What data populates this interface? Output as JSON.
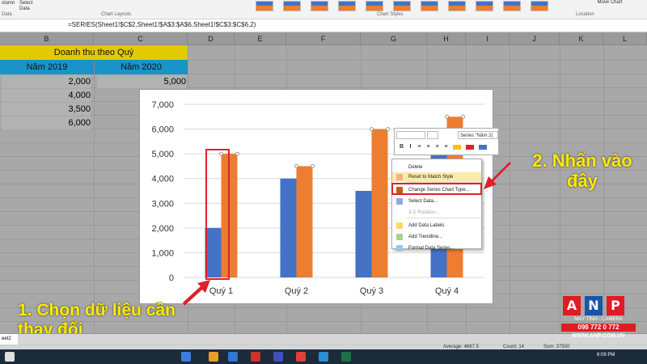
{
  "ribbon": {
    "left_buttons": [
      "Data",
      "Select",
      "Data"
    ],
    "left_labels": [
      "olumn",
      "Data"
    ],
    "chart_layouts_label": "Chart Layouts",
    "chart_styles_label": "Chart Styles",
    "move_chart_label": "Move Chart",
    "location_label": "Location"
  },
  "formula_bar": {
    "formula": "=SERIES(Sheet1!$C$2,Sheet1!$A$3:$A$6,Sheet1!$C$3:$C$6,2)"
  },
  "columns": [
    "B",
    "C",
    "D",
    "E",
    "F",
    "G",
    "H",
    "I",
    "J",
    "K",
    "L"
  ],
  "sheet": {
    "title": "Doanh thu theo Quý",
    "year_b": "Năm 2019",
    "year_c": "Năm 2020",
    "b_values": [
      "2,000",
      "4,000",
      "3,500",
      "6,000"
    ],
    "c_values": [
      "5,000"
    ]
  },
  "chart_data": {
    "type": "bar",
    "categories": [
      "Quý 1",
      "Quý 2",
      "Quý 3",
      "Quý 4"
    ],
    "series": [
      {
        "values": [
          2000,
          4000,
          3500,
          6000
        ],
        "color": "#4472c4"
      },
      {
        "values": [
          5000,
          4500,
          6000,
          6500
        ],
        "color": "#ed7d31"
      }
    ],
    "ylim": [
      0,
      7000
    ],
    "ytick_labels": [
      "0",
      "1,000",
      "2,000",
      "3,000",
      "4,000",
      "5,000",
      "6,000",
      "7,000"
    ],
    "grid": true
  },
  "mini_toolbar": {
    "series_box": "Series \"Năm 2(",
    "buttons": [
      "B",
      "I",
      "≡",
      "≡",
      "≡",
      "≡"
    ]
  },
  "context_menu": {
    "items": [
      "Delete",
      "Reset to Match Style",
      "Change Series Chart Type...",
      "Select Data...",
      "3-D Rotation...",
      "Add Data Labels",
      "Add Trendline...",
      "Format Data Series..."
    ]
  },
  "annotations": {
    "step1": "1. Chọn dữ liệu cần thay đổi",
    "step2": "2. Nhấn vào đây"
  },
  "status": {
    "sheet_tab": "eet2",
    "average": "Average: 4687.5",
    "count": "Count: 14",
    "sum": "Sum: 37500"
  },
  "taskbar": {
    "time": "6:09 PM"
  },
  "logo": {
    "letters": [
      "A",
      "N",
      "P"
    ],
    "tagline": "MÁY TÍNH - CAMERA",
    "phone": "098 772 0 772",
    "site": "WWW.ANP.COM.VN"
  },
  "colors": {
    "series_blue": "#4472c4",
    "series_orange": "#ed7d31",
    "title_fill": "#e1ca00",
    "header_fill": "#1894c8",
    "annotation_red": "#e0202c",
    "annotation_text": "#ffea00"
  }
}
